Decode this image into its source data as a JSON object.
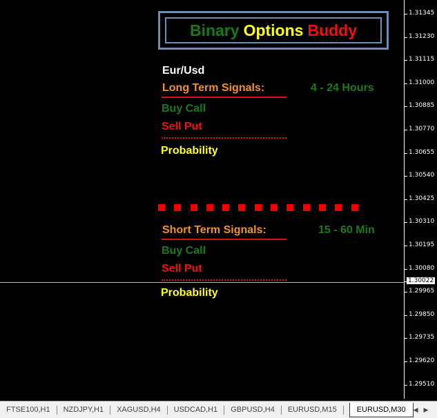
{
  "logo": {
    "word1": "Binary",
    "word2": "Options",
    "word3": "Buddy"
  },
  "pair": "Eur/Usd",
  "long_term": {
    "label": "Long Term Signals:",
    "range": "4 - 24 Hours",
    "buy": "Buy Call",
    "sell": "Sell Put",
    "probability": "Probability"
  },
  "short_term": {
    "label": "Short Term Signals:",
    "range": "15 - 60 Min",
    "buy": "Buy Call",
    "sell": "Sell Put",
    "probability": "Probability"
  },
  "price_axis": [
    "1.31345",
    "1.31230",
    "1.31115",
    "1.31000",
    "1.30885",
    "1.30770",
    "1.30655",
    "1.30540",
    "1.30425",
    "1.30310",
    "1.30195",
    "1.30080",
    "1.29965",
    "1.29850",
    "1.29735",
    "1.29620",
    "1.29510"
  ],
  "current_price": "1.30022",
  "tabs": [
    "FTSE100,H1",
    "NZDJPY,H1",
    "XAGUSD,H4",
    "USDCAD,H1",
    "GBPUSD,H4",
    "EURUSD,M15",
    "EURUSD,M30"
  ],
  "active_tab": "EURUSD,M30",
  "colors": {
    "buy": "#1a7a1a",
    "sell": "#f01010",
    "title": "#f0922c",
    "probability": "#ffff20"
  }
}
